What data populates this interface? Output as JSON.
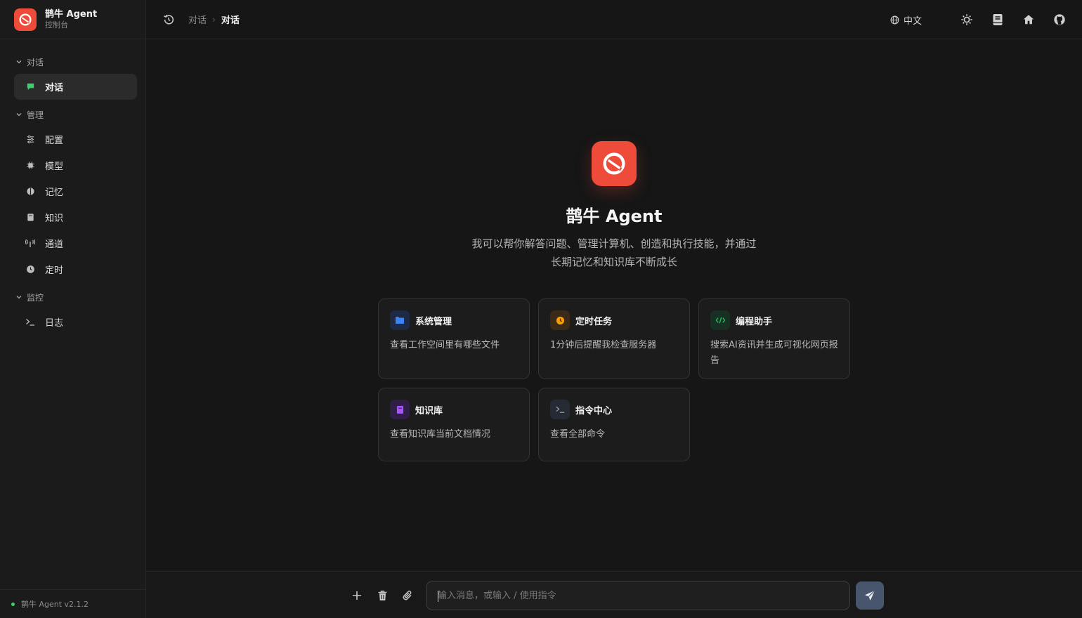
{
  "brand": {
    "title": "鹊牛 Agent",
    "subtitle": "控制台"
  },
  "sidebar": {
    "groups": [
      {
        "label": "对话",
        "items": [
          {
            "label": "对话",
            "icon": "chat-icon",
            "active": true
          }
        ]
      },
      {
        "label": "管理",
        "items": [
          {
            "label": "配置",
            "icon": "sliders-icon"
          },
          {
            "label": "模型",
            "icon": "chip-icon"
          },
          {
            "label": "记忆",
            "icon": "brain-icon"
          },
          {
            "label": "知识",
            "icon": "book-icon"
          },
          {
            "label": "通道",
            "icon": "antenna-icon"
          },
          {
            "label": "定时",
            "icon": "clock-icon"
          }
        ]
      },
      {
        "label": "监控",
        "items": [
          {
            "label": "日志",
            "icon": "terminal-icon"
          }
        ]
      }
    ],
    "footer": "鹊牛 Agent v2.1.2"
  },
  "header": {
    "breadcrumb": [
      "对话",
      "对话"
    ],
    "language": "中文"
  },
  "hero": {
    "title": "鹊牛 Agent",
    "description_line1": "我可以帮你解答问题、管理计算机、创造和执行技能，并通过",
    "description_line2": "长期记忆和知识库不断成长"
  },
  "cards": [
    {
      "title": "系统管理",
      "desc": "查看工作空间里有哪些文件",
      "icon": "folder-icon",
      "color": "#3b82f6"
    },
    {
      "title": "定时任务",
      "desc": "1分钟后提醒我检查服务器",
      "icon": "clock-icon",
      "color": "#f59e0b"
    },
    {
      "title": "编程助手",
      "desc": "搜索AI资讯并生成可视化网页报告",
      "icon": "code-icon",
      "color": "#22c55e"
    },
    {
      "title": "知识库",
      "desc": "查看知识库当前文档情况",
      "icon": "book-icon",
      "color": "#a855f7"
    },
    {
      "title": "指令中心",
      "desc": "查看全部命令",
      "icon": "terminal-icon",
      "color": "#94a3b8"
    }
  ],
  "composer": {
    "placeholder": "输入消息，或输入 / 使用指令"
  },
  "colors": {
    "accent": "#ee4b3a",
    "background": "#161616",
    "send_button": "#48566d"
  }
}
